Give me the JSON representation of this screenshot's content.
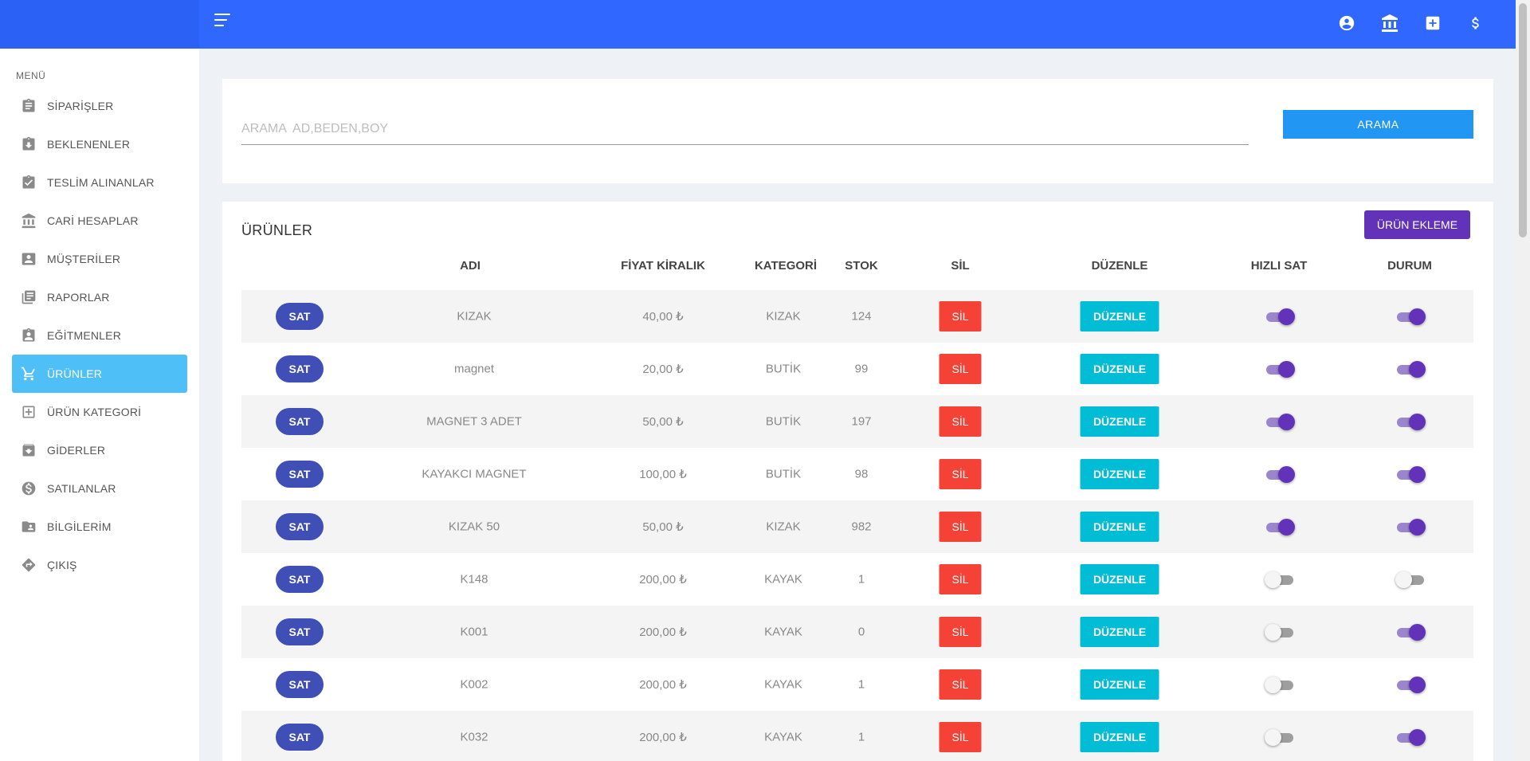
{
  "topbar": {
    "icons": [
      "account-circle-icon",
      "bank-icon",
      "plus-box-icon",
      "dollar-icon"
    ]
  },
  "sidebar": {
    "menu_title": "MENÜ",
    "items": [
      {
        "label": "SİPARİŞLER",
        "icon": "clipboard-list-icon",
        "active": false
      },
      {
        "label": "BEKLENENLER",
        "icon": "clipboard-download-icon",
        "active": false
      },
      {
        "label": "TESLİM ALINANLAR",
        "icon": "clipboard-check-icon",
        "active": false
      },
      {
        "label": "CARİ HESAPLAR",
        "icon": "bank-icon",
        "active": false
      },
      {
        "label": "MÜŞTERİLER",
        "icon": "contact-card-icon",
        "active": false
      },
      {
        "label": "RAPORLAR",
        "icon": "report-list-icon",
        "active": false
      },
      {
        "label": "EĞİTMENLER",
        "icon": "clipboard-user-icon",
        "active": false
      },
      {
        "label": "ÜRÜNLER",
        "icon": "cart-icon",
        "active": true
      },
      {
        "label": "ÜRÜN KATEGORİ",
        "icon": "add-category-icon",
        "active": false
      },
      {
        "label": "GİDERLER",
        "icon": "archive-download-icon",
        "active": false
      },
      {
        "label": "SATILANLAR",
        "icon": "dollar-circle-icon",
        "active": false
      },
      {
        "label": "BİLGİLERİM",
        "icon": "folder-user-icon",
        "active": false
      },
      {
        "label": "ÇIKIŞ",
        "icon": "exit-arrow-icon",
        "active": false
      }
    ]
  },
  "search": {
    "placeholder": "ARAMA  AD,BEDEN,BOY",
    "value": "",
    "button_label": "ARAMA"
  },
  "products": {
    "title": "ÜRÜNLER",
    "add_button_label": "ÜRÜN EKLEME",
    "columns": {
      "adi": "ADI",
      "fiyat": "FİYAT KİRALIK",
      "kategori": "KATEGORİ",
      "stok": "STOK",
      "sil": "SİL",
      "duzenle": "DÜZENLE",
      "hizli_sat": "HIZLI SAT",
      "durum": "DURUM"
    },
    "sat_label": "SAT",
    "sil_label": "SİL",
    "duzenle_label": "DÜZENLE",
    "rows": [
      {
        "adi": "KIZAK",
        "fiyat": "40,00 ₺",
        "kategori": "KIZAK",
        "stok": "124",
        "hizli_sat": true,
        "durum": true
      },
      {
        "adi": "magnet",
        "fiyat": "20,00 ₺",
        "kategori": "BUTİK",
        "stok": "99",
        "hizli_sat": true,
        "durum": true
      },
      {
        "adi": "MAGNET 3 ADET",
        "fiyat": "50,00 ₺",
        "kategori": "BUTİK",
        "stok": "197",
        "hizli_sat": true,
        "durum": true
      },
      {
        "adi": "KAYAKCI MAGNET",
        "fiyat": "100,00 ₺",
        "kategori": "BUTİK",
        "stok": "98",
        "hizli_sat": true,
        "durum": true
      },
      {
        "adi": "KIZAK 50",
        "fiyat": "50,00 ₺",
        "kategori": "KIZAK",
        "stok": "982",
        "hizli_sat": true,
        "durum": true
      },
      {
        "adi": "K148",
        "fiyat": "200,00 ₺",
        "kategori": "KAYAK",
        "stok": "1",
        "hizli_sat": false,
        "durum": false
      },
      {
        "adi": "K001",
        "fiyat": "200,00 ₺",
        "kategori": "KAYAK",
        "stok": "0",
        "hizli_sat": false,
        "durum": true
      },
      {
        "adi": "K002",
        "fiyat": "200,00 ₺",
        "kategori": "KAYAK",
        "stok": "1",
        "hizli_sat": false,
        "durum": true
      },
      {
        "adi": "K032",
        "fiyat": "200,00 ₺",
        "kategori": "KAYAK",
        "stok": "1",
        "hizli_sat": false,
        "durum": true
      }
    ]
  }
}
